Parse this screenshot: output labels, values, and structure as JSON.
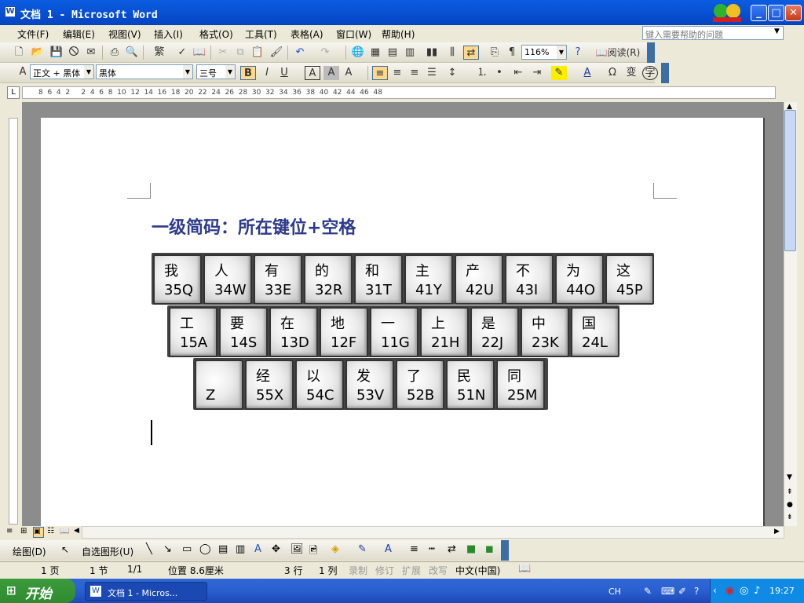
{
  "window": {
    "title": "文档 1 - Microsoft Word",
    "icon": "word-doc-icon",
    "logo": "mascot-logo"
  },
  "menubar": {
    "items": [
      "文件(F)",
      "编辑(E)",
      "视图(V)",
      "插入(I)",
      "格式(O)",
      "工具(T)",
      "表格(A)",
      "窗口(W)",
      "帮助(H)"
    ],
    "help_placeholder": "键入需要帮助的问题"
  },
  "standard_toolbar": {
    "zoom": "116%",
    "read_label": "阅读(R)",
    "format_painter": "繁"
  },
  "format_toolbar": {
    "style": "正文 + 黑体",
    "font": "黑体",
    "size": "三号",
    "bold": "B",
    "italic": "I",
    "underline": "U",
    "char_border": "A",
    "char_shade": "A",
    "char_scale": "A",
    "font_color": "A",
    "symbol": "Ω",
    "phonetic": "变",
    "enclose": "字"
  },
  "ruler": {
    "ticks": "8  6  4  2     2  4  6  8  10  12  14  16  18  20  22  24  26  28  30  32  34  36  38  40  42  44  46  48"
  },
  "document": {
    "heading": "一级简码：所在键位+空格",
    "rows": [
      [
        {
          "c": "我",
          "code": "35Q"
        },
        {
          "c": "人",
          "code": "34W"
        },
        {
          "c": "有",
          "code": "33E"
        },
        {
          "c": "的",
          "code": "32R"
        },
        {
          "c": "和",
          "code": "31T"
        },
        {
          "c": "主",
          "code": "41Y"
        },
        {
          "c": "产",
          "code": "42U"
        },
        {
          "c": "不",
          "code": "43I"
        },
        {
          "c": "为",
          "code": "44O"
        },
        {
          "c": "这",
          "code": "45P"
        }
      ],
      [
        {
          "c": "工",
          "code": "15A"
        },
        {
          "c": "要",
          "code": "14S"
        },
        {
          "c": "在",
          "code": "13D"
        },
        {
          "c": "地",
          "code": "12F"
        },
        {
          "c": "一",
          "code": "11G"
        },
        {
          "c": "上",
          "code": "21H"
        },
        {
          "c": "是",
          "code": "22J"
        },
        {
          "c": "中",
          "code": "23K"
        },
        {
          "c": "国",
          "code": "24L"
        }
      ],
      [
        {
          "c": "",
          "code": "Z"
        },
        {
          "c": "经",
          "code": "55X"
        },
        {
          "c": "以",
          "code": "54C"
        },
        {
          "c": "发",
          "code": "53V"
        },
        {
          "c": "了",
          "code": "52B"
        },
        {
          "c": "民",
          "code": "51N"
        },
        {
          "c": "同",
          "code": "25M"
        }
      ]
    ]
  },
  "drawing_toolbar": {
    "draw_label": "绘图(D)",
    "autoshape_label": "自选图形(U)"
  },
  "status": {
    "page": "1 页",
    "section": "1 节",
    "pages": "1/1",
    "position": "位置 8.6厘米",
    "line": "3 行",
    "col": "1 列",
    "rec": "录制",
    "trk": "修订",
    "ext": "扩展",
    "ovr": "改写",
    "lang": "中文(中国)"
  },
  "taskbar": {
    "start": "开始",
    "task": "文档 1 - Micros...",
    "ime": "CH",
    "clock": "19:27"
  },
  "colors": {
    "title_blue": "#0853d6",
    "heading": "#2e3a8c",
    "start_green": "#3c9a3c"
  }
}
